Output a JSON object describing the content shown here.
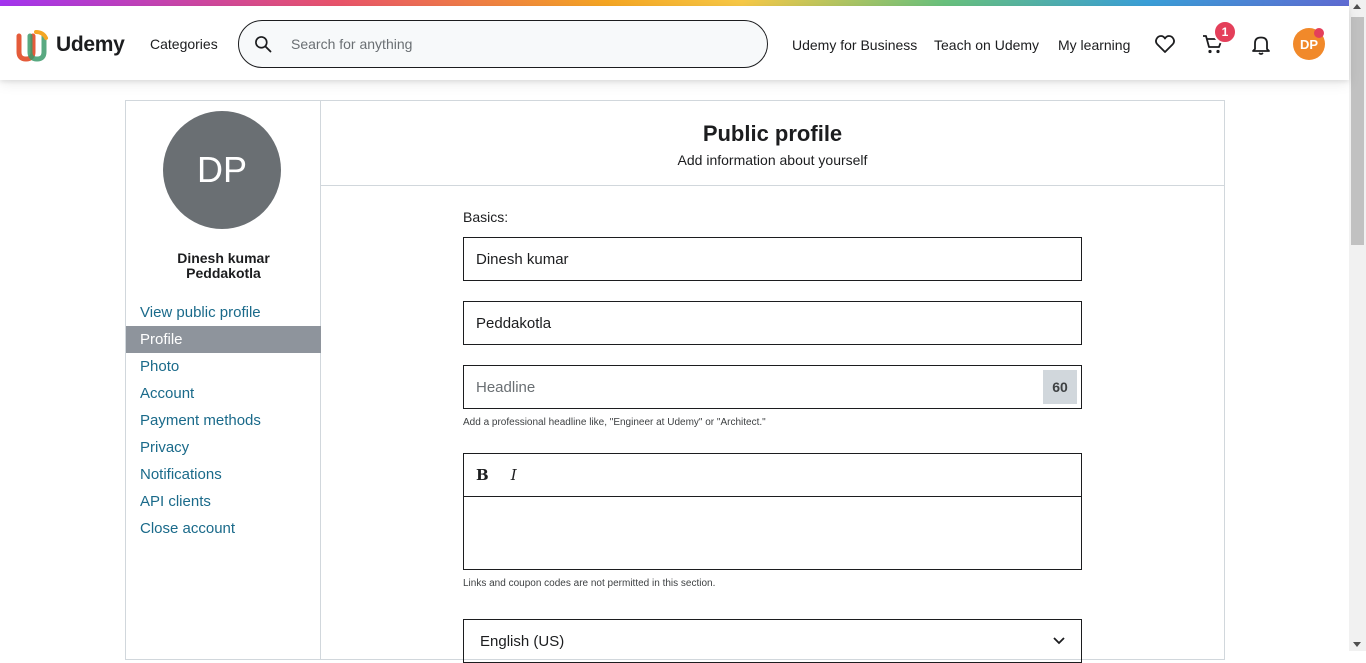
{
  "header": {
    "logo_text": "Udemy",
    "categories": "Categories",
    "search_placeholder": "Search for anything",
    "nav": [
      "Udemy for Business",
      "Teach on Udemy",
      "My learning"
    ],
    "cart_count": "1",
    "avatar_initials": "DP"
  },
  "sidebar": {
    "avatar_initials": "DP",
    "name_line1": "Dinesh kumar",
    "name_line2": "Peddakotla",
    "items": [
      {
        "label": "View public profile"
      },
      {
        "label": "Profile"
      },
      {
        "label": "Photo"
      },
      {
        "label": "Account"
      },
      {
        "label": "Payment methods"
      },
      {
        "label": "Privacy"
      },
      {
        "label": "Notifications"
      },
      {
        "label": "API clients"
      },
      {
        "label": "Close account"
      }
    ],
    "active_item": "Profile"
  },
  "main": {
    "title": "Public profile",
    "subtitle": "Add information about yourself",
    "basics_label": "Basics:",
    "first_name": "Dinesh kumar",
    "last_name": "Peddakotla",
    "headline_placeholder": "Headline",
    "headline_counter": "60",
    "headline_hint": "Add a professional headline like, \"Engineer at Udemy\" or \"Architect.\"",
    "bold_label": "B",
    "italic_label": "I",
    "bio_hint": "Links and coupon codes are not permitted in this section.",
    "language": "English (US)"
  },
  "colors": {
    "link": "#1a6a8a",
    "active_bg": "#8e949c",
    "badge": "#e43f5a",
    "avatar_small": "#f1892a",
    "avatar_big": "#6a6f73"
  }
}
